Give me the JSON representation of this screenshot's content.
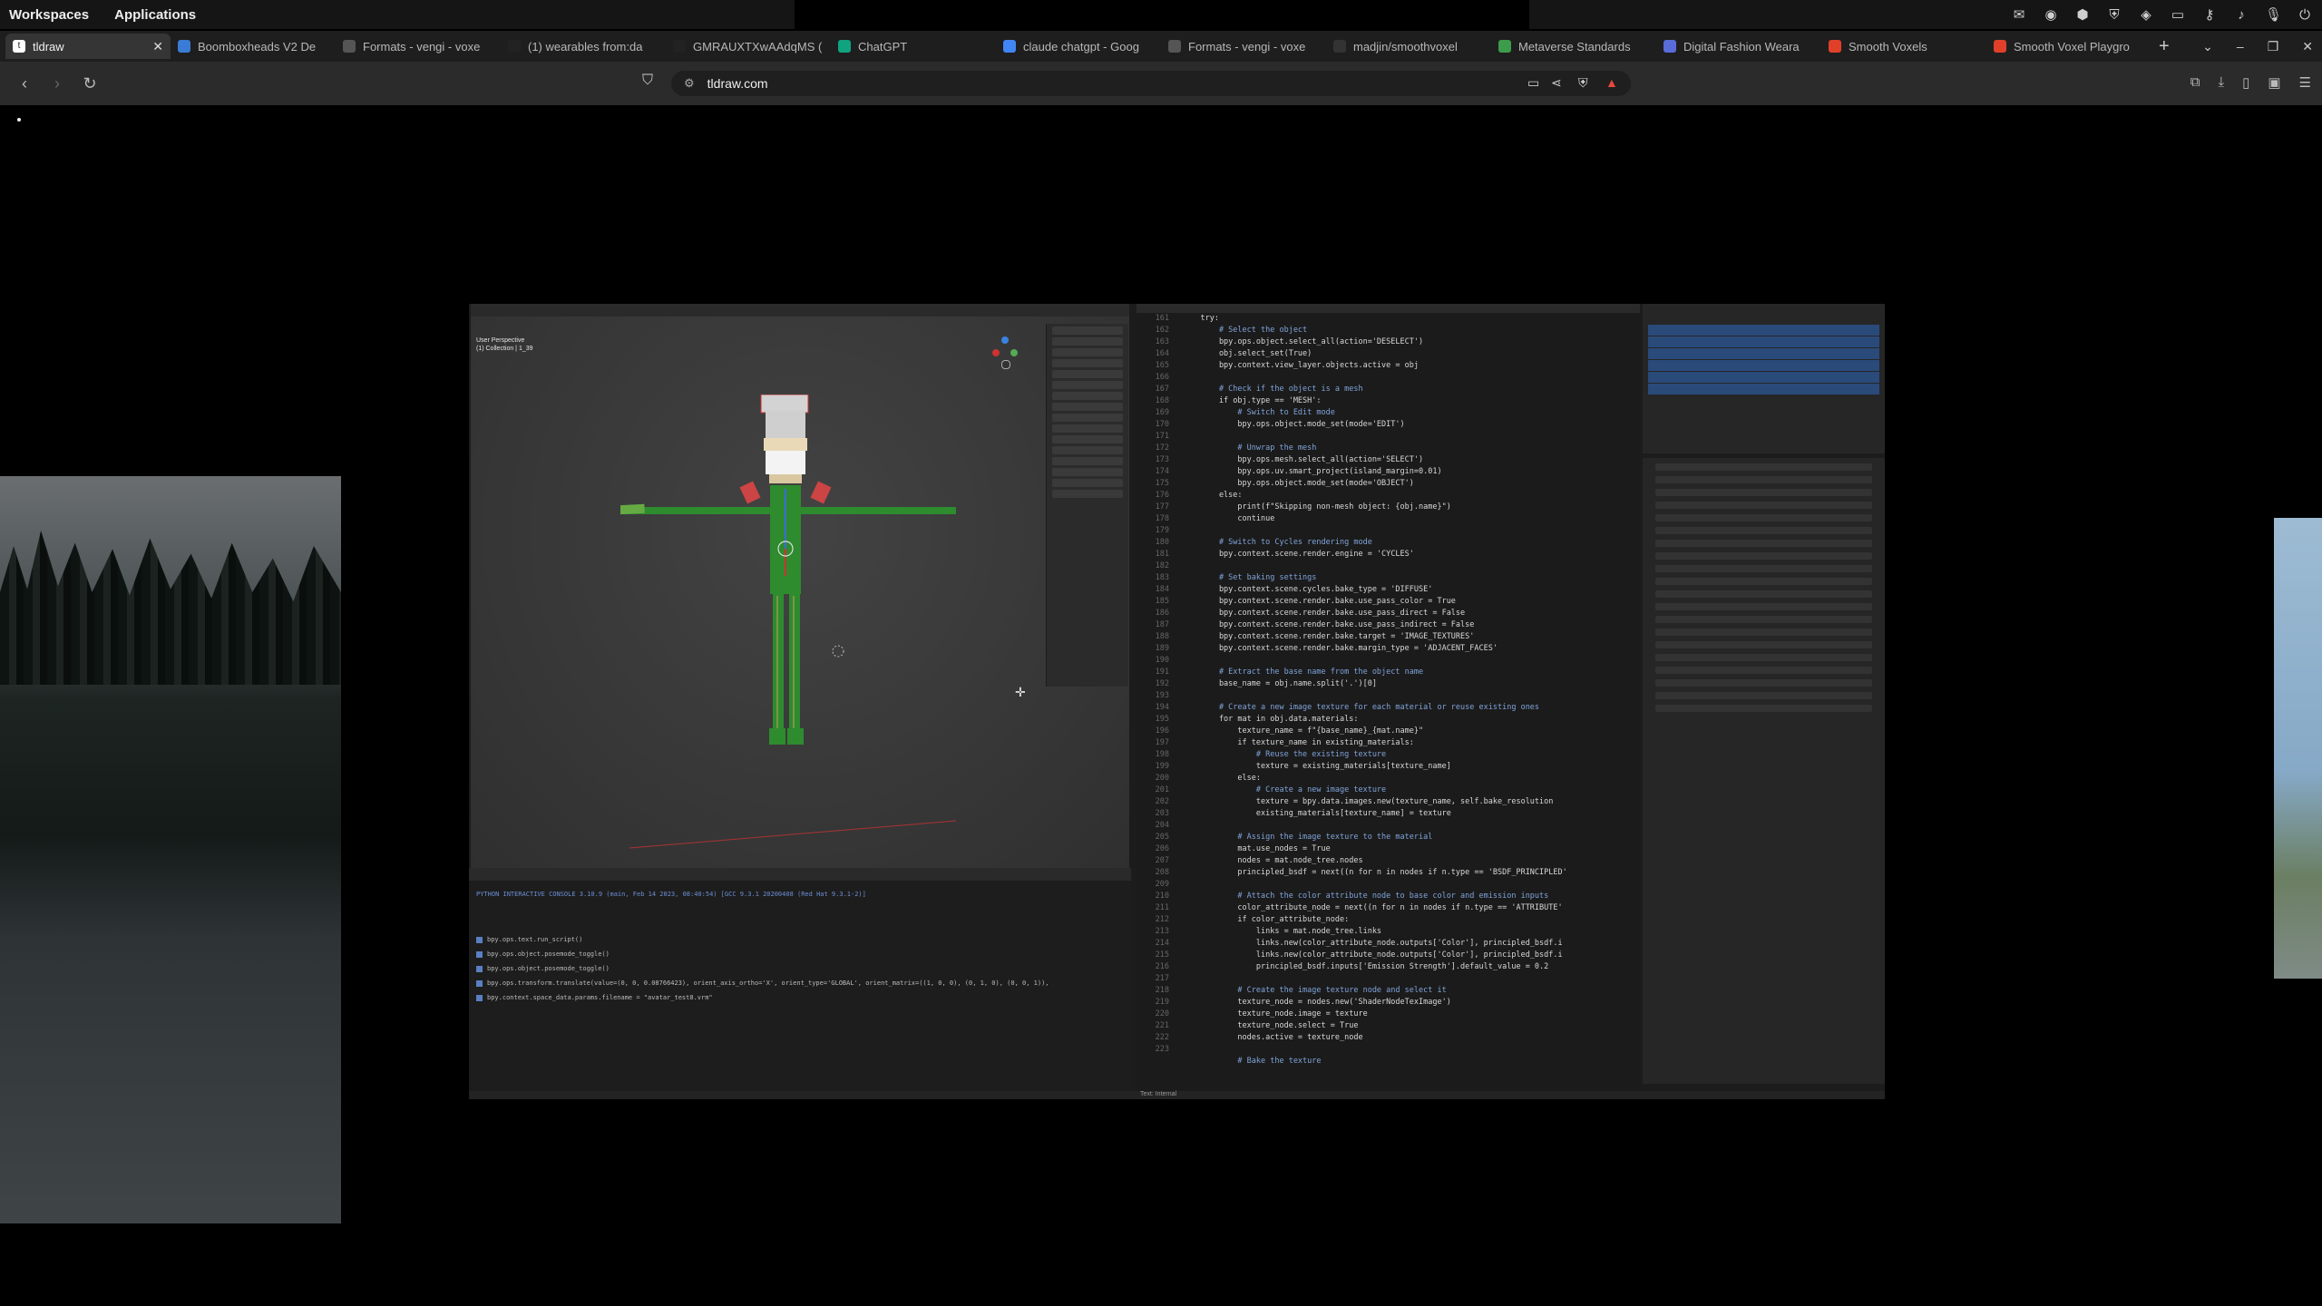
{
  "topbar": {
    "workspaces": "Workspaces",
    "applications": "Applications",
    "tray_icons": [
      "mail-icon",
      "app-icon",
      "vpn-icon",
      "shield-icon",
      "discord-icon",
      "window-icon",
      "key-icon",
      "volume-icon",
      "mic-icon",
      "power-icon"
    ]
  },
  "tabs": [
    {
      "title": "tldraw",
      "active": true,
      "icon": "tldraw-icon",
      "color": "#ffffff"
    },
    {
      "title": "Boomboxheads V2 De",
      "icon": "globe-icon",
      "color": "#3a7bd5"
    },
    {
      "title": "Formats - vengi - voxe",
      "icon": "vengi-icon",
      "color": "#555555"
    },
    {
      "title": "(1) wearables from:da",
      "icon": "x-icon",
      "color": "#222222"
    },
    {
      "title": "GMRAUXTXwAAdqMS (",
      "icon": "x-icon",
      "color": "#222222"
    },
    {
      "title": "ChatGPT",
      "icon": "chatgpt-icon",
      "color": "#10a37f"
    },
    {
      "title": "claude chatgpt - Goog",
      "icon": "google-icon",
      "color": "#4285f4"
    },
    {
      "title": "Formats - vengi - voxe",
      "icon": "vengi-icon",
      "color": "#555555"
    },
    {
      "title": "madjin/smoothvoxel",
      "icon": "github-icon",
      "color": "#333333"
    },
    {
      "title": "Metaverse Standards",
      "icon": "metaverse-icon",
      "color": "#3c9c4a"
    },
    {
      "title": "Digital Fashion Weara",
      "icon": "fashion-icon",
      "color": "#5a6cd8"
    },
    {
      "title": "Smooth Voxels",
      "icon": "voxel-icon",
      "color": "#e0402a"
    },
    {
      "title": "Smooth Voxel Playgro",
      "icon": "voxel-icon",
      "color": "#e0402a"
    }
  ],
  "toolbar": {
    "url": "tldraw.com",
    "back": "‹",
    "forward": "›",
    "reload": "↻"
  },
  "blender": {
    "viewport_title": [
      "User Perspective",
      "(1) Collection | 1_39"
    ],
    "console_header": "PYTHON INTERACTIVE CONSOLE 3.10.9 (main, Feb 14 2023, 08:40:54) [GCC 9.3.1 20200408 (Red Hat 9.3.1-2)]",
    "console_lines": [
      "bpy.ops.text.run_script()",
      "bpy.ops.object.posemode_toggle()",
      "bpy.ops.object.posemode_toggle()",
      "bpy.ops.transform.translate(value=(0, 0, 0.08766423), orient_axis_ortho='X', orient_type='GLOBAL', orient_matrix=((1, 0, 0), (0, 1, 0), (0, 0, 1)),",
      "bpy.context.space_data.params.filename = \"avatar_test8.vrm\""
    ],
    "line_numbers": [
      "161",
      "162",
      "163",
      "164",
      "165",
      "166",
      "167",
      "168",
      "169",
      "170",
      "171",
      "172",
      "173",
      "174",
      "175",
      "176",
      "177",
      "178",
      "179",
      "180",
      "181",
      "182",
      "183",
      "184",
      "185",
      "186",
      "187",
      "188",
      "189",
      "190",
      "191",
      "192",
      "193",
      "194",
      "195",
      "196",
      "197",
      "198",
      "199",
      "200",
      "201",
      "202",
      "203",
      "204",
      "205",
      "206",
      "207",
      "208",
      "209",
      "210",
      "211",
      "212",
      "213",
      "214",
      "215",
      "216",
      "217",
      "218",
      "219",
      "220",
      "221",
      "222",
      "223"
    ],
    "code": [
      "    try:",
      "        # Select the object",
      "        bpy.ops.object.select_all(action='DESELECT')",
      "        obj.select_set(True)",
      "        bpy.context.view_layer.objects.active = obj",
      "",
      "        # Check if the object is a mesh",
      "        if obj.type == 'MESH':",
      "            # Switch to Edit mode",
      "            bpy.ops.object.mode_set(mode='EDIT')",
      "",
      "            # Unwrap the mesh",
      "            bpy.ops.mesh.select_all(action='SELECT')",
      "            bpy.ops.uv.smart_project(island_margin=0.01)",
      "            bpy.ops.object.mode_set(mode='OBJECT')",
      "        else:",
      "            print(f\"Skipping non-mesh object: {obj.name}\")",
      "            continue",
      "",
      "        # Switch to Cycles rendering mode",
      "        bpy.context.scene.render.engine = 'CYCLES'",
      "",
      "        # Set baking settings",
      "        bpy.context.scene.cycles.bake_type = 'DIFFUSE'",
      "        bpy.context.scene.render.bake.use_pass_color = True",
      "        bpy.context.scene.render.bake.use_pass_direct = False",
      "        bpy.context.scene.render.bake.use_pass_indirect = False",
      "        bpy.context.scene.render.bake.target = 'IMAGE_TEXTURES'",
      "        bpy.context.scene.render.bake.margin_type = 'ADJACENT_FACES'",
      "",
      "        # Extract the base name from the object name",
      "        base_name = obj.name.split('.')[0]",
      "",
      "        # Create a new image texture for each material or reuse existing ones",
      "        for mat in obj.data.materials:",
      "            texture_name = f\"{base_name}_{mat.name}\"",
      "            if texture_name in existing_materials:",
      "                # Reuse the existing texture",
      "                texture = existing_materials[texture_name]",
      "            else:",
      "                # Create a new image texture",
      "                texture = bpy.data.images.new(texture_name, self.bake_resolution",
      "                existing_materials[texture_name] = texture",
      "",
      "            # Assign the image texture to the material",
      "            mat.use_nodes = True",
      "            nodes = mat.node_tree.nodes",
      "            principled_bsdf = next((n for n in nodes if n.type == 'BSDF_PRINCIPLED'",
      "",
      "            # Attach the color attribute node to base color and emission inputs",
      "            color_attribute_node = next((n for n in nodes if n.type == 'ATTRIBUTE'",
      "            if color_attribute_node:",
      "                links = mat.node_tree.links",
      "                links.new(color_attribute_node.outputs['Color'], principled_bsdf.i",
      "                links.new(color_attribute_node.outputs['Color'], principled_bsdf.i",
      "                principled_bsdf.inputs['Emission Strength'].default_value = 0.2",
      "",
      "            # Create the image texture node and select it",
      "            texture_node = nodes.new('ShaderNodeTexImage')",
      "            texture_node.image = texture",
      "            texture_node.select = True",
      "            nodes.active = texture_node",
      "",
      "            # Bake the texture"
    ],
    "status_left": "Text: Internal"
  },
  "colors": {
    "figure_green": "#2e8b2e",
    "figure_hat": "#c8c8c8",
    "accent_red": "#c43030",
    "selection_blue": "#2a4a7a"
  }
}
